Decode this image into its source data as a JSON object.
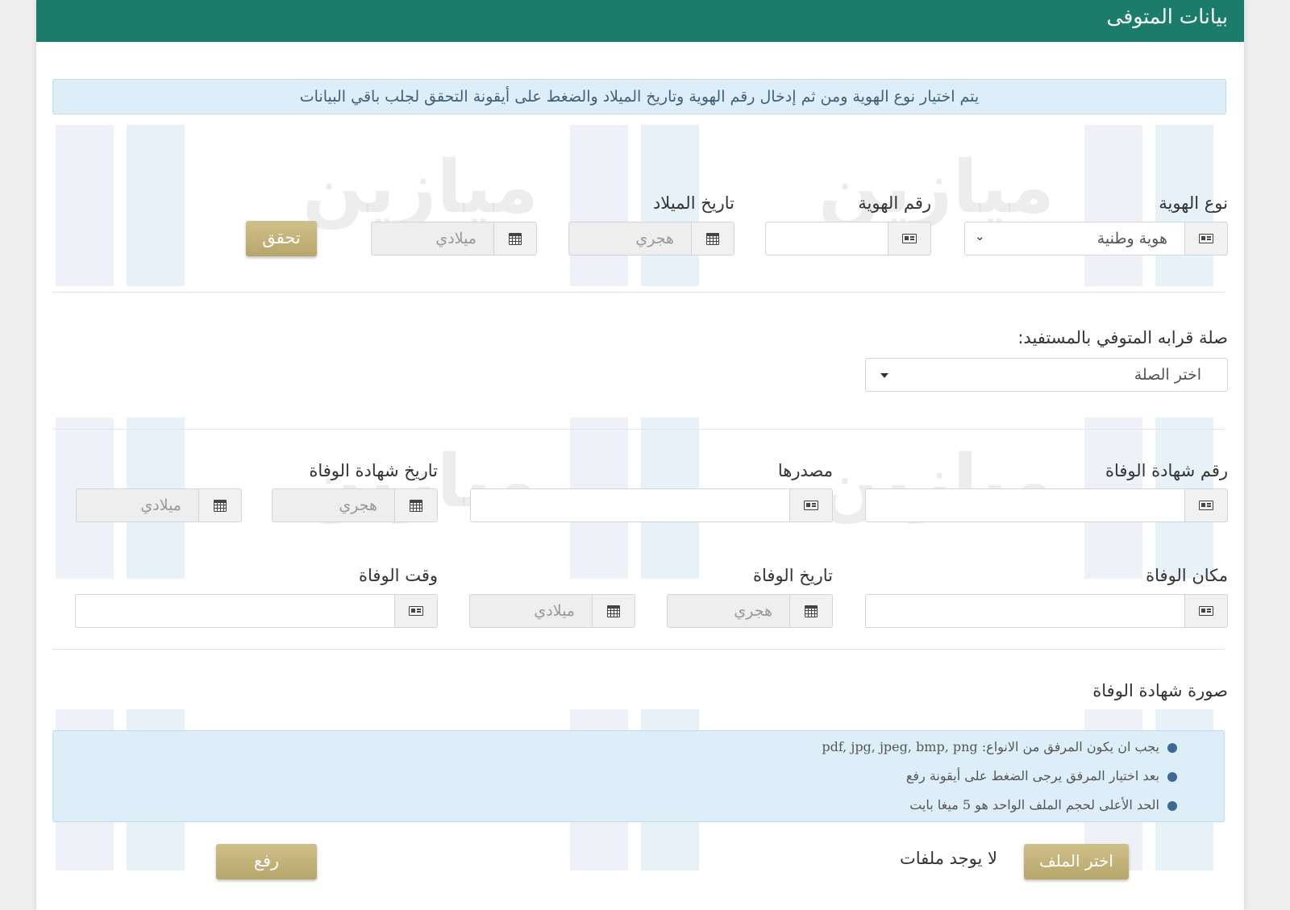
{
  "header": {
    "title": "بيانات المتوفى"
  },
  "watermark": {
    "text": "ميازين"
  },
  "info": {
    "text": "يتم اختيار نوع الهوية ومن ثم إدخال رقم الهوية وتاريخ الميلاد والضغط على أيقونة التحقق لجلب باقي البيانات"
  },
  "identity": {
    "type_label": "نوع الهوية",
    "type_value": "هوية وطنية",
    "number_label": "رقم الهوية",
    "number_value": "",
    "birth_label": "تاريخ الميلاد",
    "birth_hijri_placeholder": "هجري",
    "birth_gregorian_placeholder": "ميلادي",
    "verify_button": "تحقق"
  },
  "relation": {
    "label": "صلة قرابه المتوفي بالمستفيد:",
    "selected": "اختر الصلة"
  },
  "death": {
    "cert_number_label": "رقم شهادة الوفاة",
    "cert_source_label": "مصدرها",
    "cert_date_label": "تاريخ شهادة الوفاة",
    "cert_date_hijri_placeholder": "هجري",
    "cert_date_gregorian_placeholder": "ميلادي",
    "place_label": "مكان الوفاة",
    "date_label": "تاريخ الوفاة",
    "date_hijri_placeholder": "هجري",
    "date_gregorian_placeholder": "ميلادي",
    "time_label": "وقت الوفاة"
  },
  "attachment": {
    "title": "صورة شهادة الوفاة",
    "notes": [
      "يجب ان يكون المرفق من الانواع: pdf, jpg, jpeg, bmp, png",
      "بعد اختيار المرفق يرجى الضغط على أيقونة رفع",
      "الحد الأعلى لحجم الملف الواحد هو 5 ميغا بايت"
    ],
    "choose_button": "اختر الملف",
    "no_files": "لا يوجد ملفات",
    "upload_button": "رفع"
  },
  "colors": {
    "header": "#1b7c6a",
    "gold_button": "#c2b278",
    "info_bg": "#ddeef8"
  }
}
